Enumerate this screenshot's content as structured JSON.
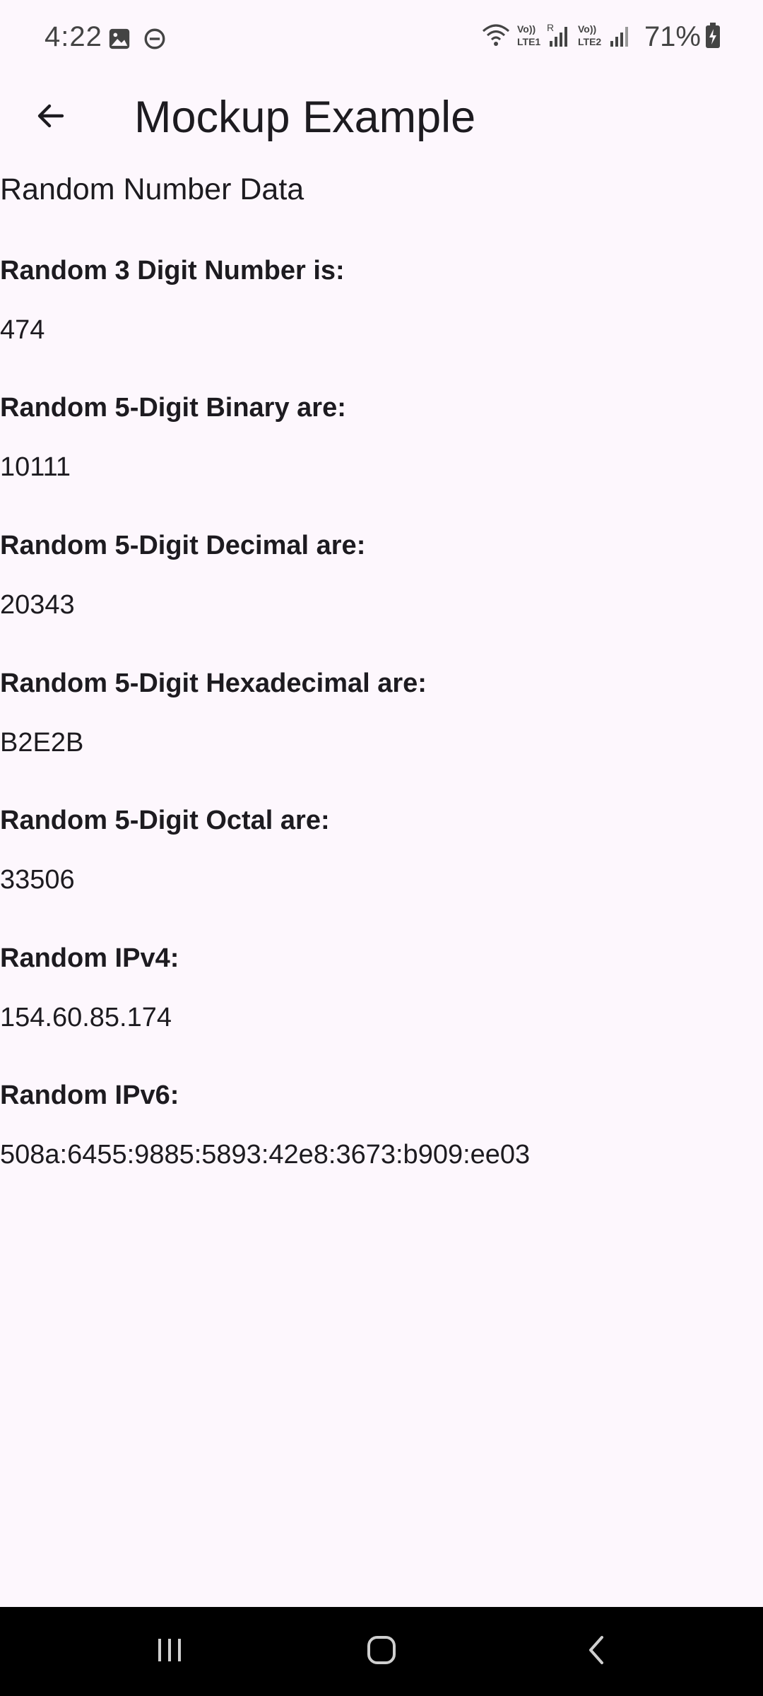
{
  "status_bar": {
    "time": "4:22",
    "battery": "71%",
    "icons": [
      "image-icon",
      "do-not-disturb-icon",
      "wifi-icon",
      "lte1-signal-icon",
      "lte2-signal-icon",
      "battery-charging-icon"
    ]
  },
  "app_bar": {
    "title": "Mockup Example",
    "back_icon": "arrow-back-icon"
  },
  "content": {
    "section_title": "Random Number Data",
    "items": [
      {
        "label": "Random 3 Digit Number is:",
        "value": "474"
      },
      {
        "label": "Random 5-Digit Binary are:",
        "value": "10111"
      },
      {
        "label": "Random 5-Digit Decimal are:",
        "value": "20343"
      },
      {
        "label": "Random 5-Digit Hexadecimal are:",
        "value": "B2E2B"
      },
      {
        "label": "Random 5-Digit Octal are:",
        "value": "33506"
      },
      {
        "label": "Random IPv4:",
        "value": "154.60.85.174"
      },
      {
        "label": "Random IPv6:",
        "value": "508a:6455:9885:5893:42e8:3673:b909:ee03"
      }
    ]
  },
  "nav_bar": {
    "icons": [
      "recent-apps-icon",
      "home-icon",
      "back-icon"
    ]
  }
}
